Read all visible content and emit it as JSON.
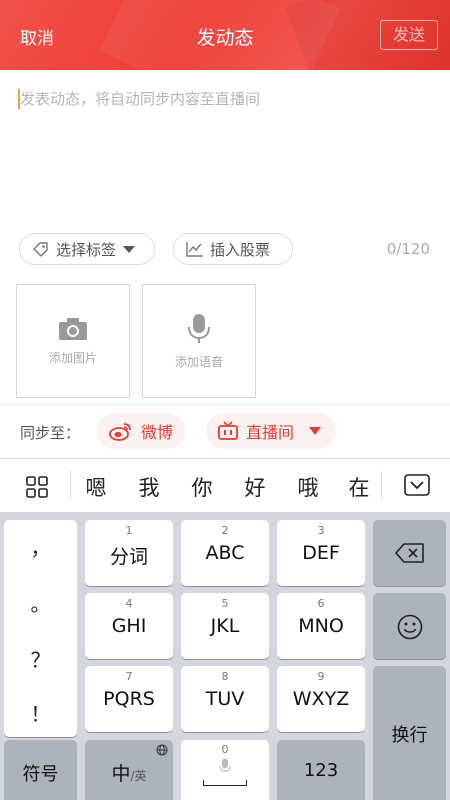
{
  "header": {
    "cancel": "取消",
    "title": "发动态",
    "send": "发送"
  },
  "compose": {
    "placeholder": "发表动态，将自动同步内容至直播间",
    "char_counter": "0/120"
  },
  "toolbar": {
    "tag_label": "选择标签",
    "stock_label": "插入股票"
  },
  "media": {
    "photo_label": "添加图片",
    "voice_label": "添加语音"
  },
  "sync": {
    "label": "同步至：",
    "weibo": "微博",
    "live": "直播间"
  },
  "candidates": [
    "嗯",
    "我",
    "你",
    "好",
    "哦",
    "在"
  ],
  "keyboard": {
    "punctuation": [
      "，",
      "。",
      "？",
      "！"
    ],
    "keys": [
      {
        "num": "1",
        "label": "分词"
      },
      {
        "num": "2",
        "label": "ABC"
      },
      {
        "num": "3",
        "label": "DEF"
      },
      {
        "num": "4",
        "label": "GHI"
      },
      {
        "num": "5",
        "label": "JKL"
      },
      {
        "num": "6",
        "label": "MNO"
      },
      {
        "num": "7",
        "label": "PQRS"
      },
      {
        "num": "8",
        "label": "TUV"
      },
      {
        "num": "9",
        "label": "WXYZ"
      }
    ],
    "symbols": "符号",
    "lang_main": "中",
    "lang_alt": "/英",
    "space_num": "0",
    "numbers": "123",
    "enter": "换行"
  },
  "colors": {
    "brand_red": "#ee3b34",
    "accent_light": "#fbf1f1",
    "keyboard_bg": "#d3d6dc"
  },
  "icons": {
    "tag": "tag-icon",
    "chart": "chart-icon",
    "camera": "camera-icon",
    "mic": "microphone-icon",
    "weibo": "weibo-icon",
    "tv": "tv-icon",
    "grid": "grid-icon",
    "hide_keyboard": "keyboard-hide-icon",
    "backspace": "backspace-icon",
    "emoji": "emoji-icon",
    "globe": "globe-icon"
  }
}
